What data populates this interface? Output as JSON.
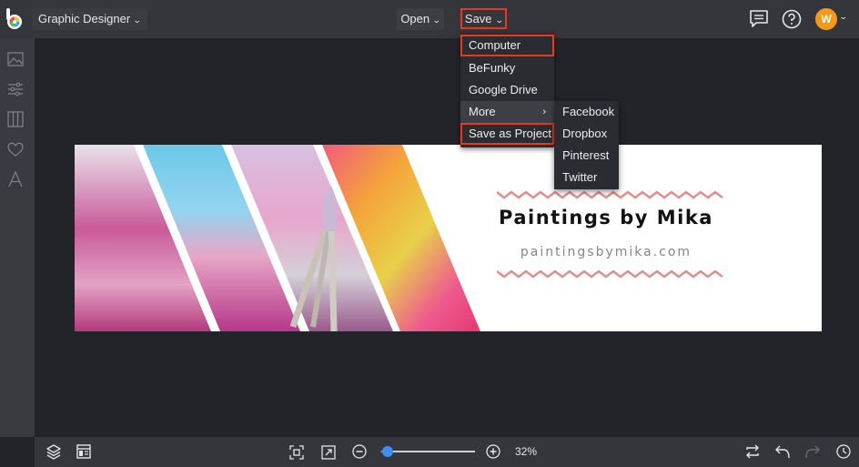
{
  "topbar": {
    "app_name": "Graphic Designer",
    "open_label": "Open",
    "save_label": "Save",
    "avatar_initial": "W",
    "icons": [
      "befunky-logo-icon",
      "comments-icon",
      "help-icon",
      "user-avatar"
    ]
  },
  "sidebar": {
    "icons": [
      "image-manager-icon",
      "adjust-sliders-icon",
      "layouts-icon",
      "favorites-heart-icon",
      "text-icon"
    ]
  },
  "save_menu": {
    "items": [
      {
        "label": "Computer"
      },
      {
        "label": "BeFunky"
      },
      {
        "label": "Google Drive"
      },
      {
        "label": "More"
      },
      {
        "label": "Save as Project"
      }
    ],
    "more_submenu": [
      {
        "label": "Facebook"
      },
      {
        "label": "Dropbox"
      },
      {
        "label": "Pinterest"
      },
      {
        "label": "Twitter"
      }
    ]
  },
  "canvas": {
    "title": "Paintings by Mika",
    "url": "paintingsbymika.com"
  },
  "bottombar": {
    "zoom_label": "32%",
    "zoom_fraction": 0.04,
    "icons": [
      "layers-icon",
      "layout-icon",
      "fit-to-screen-icon",
      "actual-size-icon",
      "zoom-out-icon",
      "zoom-in-icon",
      "swap-icon",
      "undo-icon",
      "redo-icon",
      "history-icon"
    ]
  },
  "colors": {
    "highlight": "#e53a1e",
    "accent": "#3d8ff0",
    "avatar": "#f29a1a",
    "zigzag": "#e0908a"
  }
}
